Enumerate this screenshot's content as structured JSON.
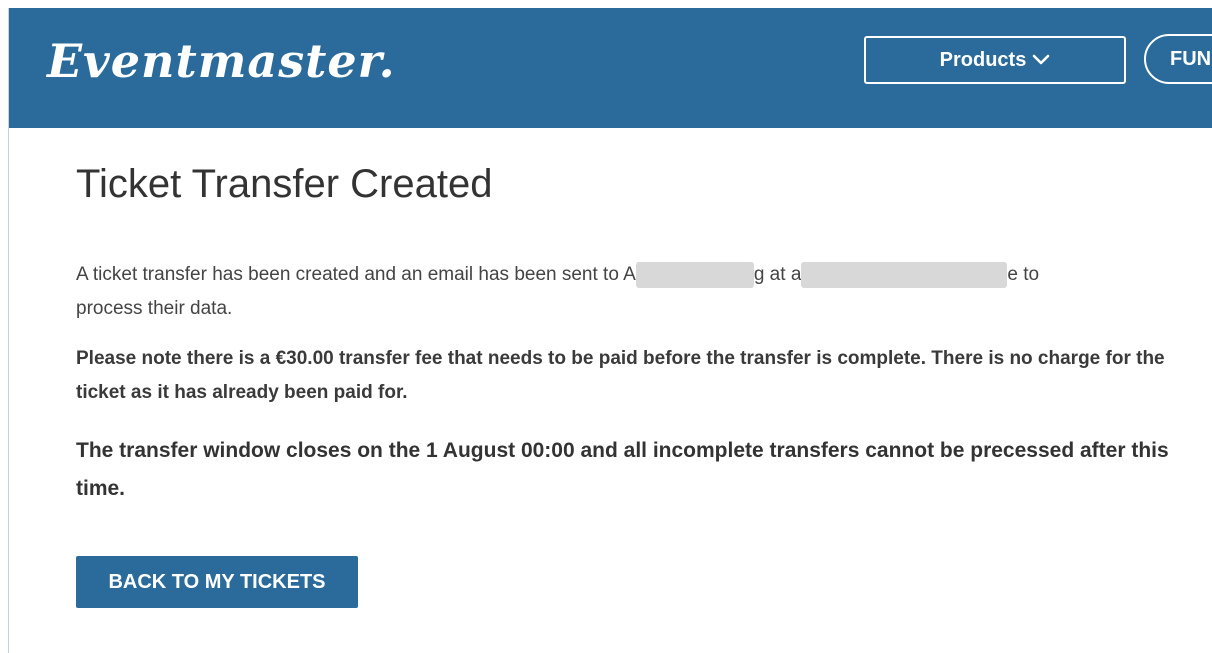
{
  "header": {
    "logo": "Eventmaster.",
    "nav": {
      "products_label": "Products",
      "fun_label": "FUN"
    }
  },
  "main": {
    "title": "Ticket Transfer Created",
    "message": {
      "part1": "A ticket transfer has been created and an email has been sent to",
      "frag_a": "A",
      "frag_b": "g at",
      "frag_c": "a",
      "frag_d": "e to",
      "part2": "process their data."
    },
    "fee_note": "Please note there is a €30.00 transfer fee that needs to be paid before the transfer is complete. There is no charge for the ticket as it has already been paid for.",
    "window_note": "The transfer window closes on the 1 August 00:00 and all incomplete transfers cannot be precessed after this time.",
    "back_button_label": "BACK TO MY TICKETS"
  },
  "colors": {
    "brand": "#2b6b9b",
    "text": "#333333"
  }
}
